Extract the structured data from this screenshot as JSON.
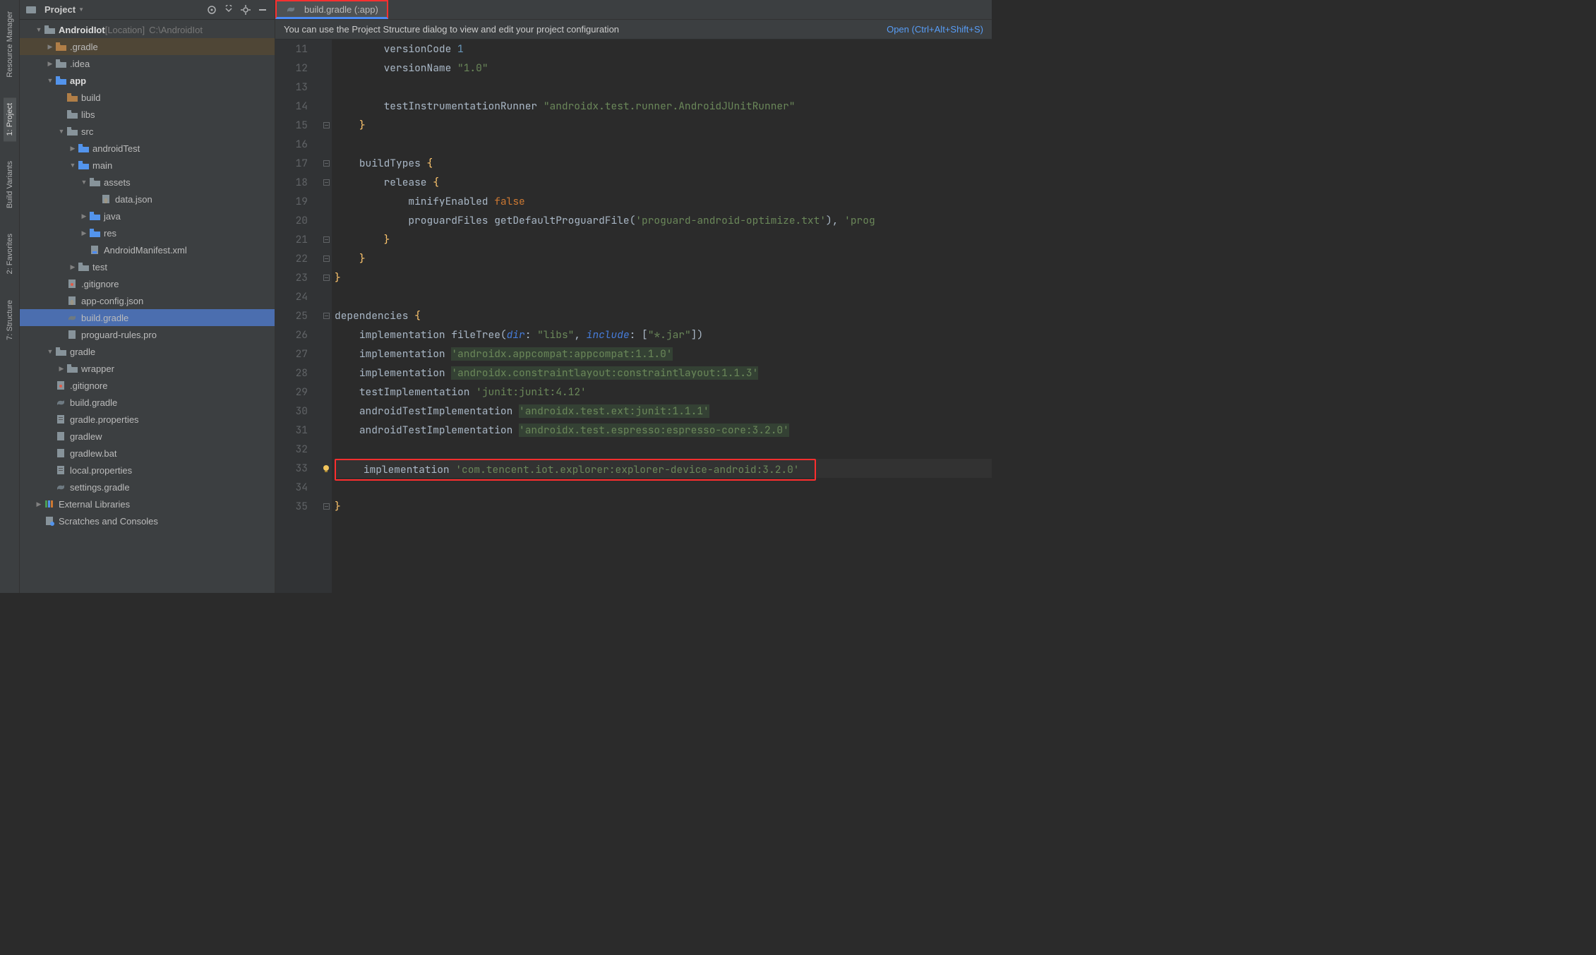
{
  "sidebar": {
    "mode": "Project",
    "root": {
      "name": "AndroidIot",
      "bracket": "[Location]",
      "path": "C:\\AndroidIot"
    },
    "items": [
      {
        "indent": 1,
        "arrow": "down",
        "iconColor": "folder",
        "label": "AndroidIot",
        "bracket": "[Location]",
        "extra": "C:\\AndroidIot",
        "bold": true
      },
      {
        "indent": 2,
        "arrow": "right",
        "iconColor": "folder-y",
        "label": ".gradle",
        "hl": true
      },
      {
        "indent": 2,
        "arrow": "right",
        "iconColor": "folder",
        "label": ".idea"
      },
      {
        "indent": 2,
        "arrow": "down",
        "iconColor": "folder-b",
        "label": "app",
        "bold": true
      },
      {
        "indent": 3,
        "arrow": "",
        "iconColor": "folder-y",
        "label": "build"
      },
      {
        "indent": 3,
        "arrow": "",
        "iconColor": "folder",
        "label": "libs"
      },
      {
        "indent": 3,
        "arrow": "down",
        "iconColor": "folder",
        "label": "src"
      },
      {
        "indent": 4,
        "arrow": "right",
        "iconColor": "folder-b",
        "label": "androidTest"
      },
      {
        "indent": 4,
        "arrow": "down",
        "iconColor": "folder-b",
        "label": "main"
      },
      {
        "indent": 5,
        "arrow": "down",
        "iconColor": "folder",
        "label": "assets",
        "badge": true
      },
      {
        "indent": 6,
        "arrow": "",
        "iconColor": "file",
        "label": "data.json",
        "fileType": "json"
      },
      {
        "indent": 5,
        "arrow": "right",
        "iconColor": "folder-b",
        "label": "java"
      },
      {
        "indent": 5,
        "arrow": "right",
        "iconColor": "folder-b",
        "label": "res"
      },
      {
        "indent": 5,
        "arrow": "",
        "iconColor": "file",
        "label": "AndroidManifest.xml",
        "fileType": "manifest"
      },
      {
        "indent": 4,
        "arrow": "right",
        "iconColor": "folder",
        "label": "test"
      },
      {
        "indent": 3,
        "arrow": "",
        "iconColor": "file",
        "label": ".gitignore",
        "fileType": "gitignore"
      },
      {
        "indent": 3,
        "arrow": "",
        "iconColor": "file",
        "label": "app-config.json",
        "fileType": "json"
      },
      {
        "indent": 3,
        "arrow": "",
        "iconColor": "file",
        "label": "build.gradle",
        "fileType": "gradle",
        "selected": true
      },
      {
        "indent": 3,
        "arrow": "",
        "iconColor": "file",
        "label": "proguard-rules.pro",
        "fileType": "txt"
      },
      {
        "indent": 2,
        "arrow": "down",
        "iconColor": "folder",
        "label": "gradle"
      },
      {
        "indent": 3,
        "arrow": "right",
        "iconColor": "folder",
        "label": "wrapper"
      },
      {
        "indent": 2,
        "arrow": "",
        "iconColor": "file",
        "label": ".gitignore",
        "fileType": "gitignore"
      },
      {
        "indent": 2,
        "arrow": "",
        "iconColor": "file",
        "label": "build.gradle",
        "fileType": "gradle"
      },
      {
        "indent": 2,
        "arrow": "",
        "iconColor": "file",
        "label": "gradle.properties",
        "fileType": "props"
      },
      {
        "indent": 2,
        "arrow": "",
        "iconColor": "file",
        "label": "gradlew",
        "fileType": "txt"
      },
      {
        "indent": 2,
        "arrow": "",
        "iconColor": "file",
        "label": "gradlew.bat",
        "fileType": "txt"
      },
      {
        "indent": 2,
        "arrow": "",
        "iconColor": "file",
        "label": "local.properties",
        "fileType": "props"
      },
      {
        "indent": 2,
        "arrow": "",
        "iconColor": "file",
        "label": "settings.gradle",
        "fileType": "gradle"
      },
      {
        "indent": 1,
        "arrow": "right",
        "iconColor": "lib",
        "label": "External Libraries"
      },
      {
        "indent": 1,
        "arrow": "",
        "iconColor": "scratch",
        "label": "Scratches and Consoles"
      }
    ]
  },
  "leftGutter": [
    {
      "label": "Resource Manager"
    },
    {
      "label": "1: Project",
      "active": true
    },
    {
      "label": "Build Variants"
    },
    {
      "label": "2: Favorites"
    },
    {
      "label": "7: Structure"
    }
  ],
  "tab": {
    "label": "build.gradle (:app)"
  },
  "infoBar": {
    "msg": "You can use the Project Structure dialog to view and edit your project configuration",
    "link": "Open (Ctrl+Alt+Shift+S)"
  },
  "code": {
    "startLine": 11,
    "lines": [
      {
        "n": 11,
        "fold": "",
        "tokens": [
          [
            "        ",
            ""
          ],
          [
            "versionCode ",
            "id"
          ],
          [
            "1",
            "num"
          ]
        ]
      },
      {
        "n": 12,
        "fold": "",
        "tokens": [
          [
            "        ",
            ""
          ],
          [
            "versionName ",
            "id"
          ],
          [
            "\"1.0\"",
            "str"
          ]
        ]
      },
      {
        "n": 13,
        "fold": "",
        "tokens": [
          [
            "",
            ""
          ]
        ]
      },
      {
        "n": 14,
        "fold": "",
        "tokens": [
          [
            "        ",
            ""
          ],
          [
            "testInstrumentationRunner ",
            "id"
          ],
          [
            "\"androidx.test.runner.AndroidJUnitRunner\"",
            "str"
          ]
        ]
      },
      {
        "n": 15,
        "fold": "⊟",
        "tokens": [
          [
            "    ",
            ""
          ],
          [
            "}",
            "bracey"
          ]
        ]
      },
      {
        "n": 16,
        "fold": "",
        "tokens": [
          [
            "",
            ""
          ]
        ]
      },
      {
        "n": 17,
        "fold": "⊟",
        "tokens": [
          [
            "    ",
            ""
          ],
          [
            "buildTypes ",
            "id"
          ],
          [
            "{",
            "bracey"
          ]
        ]
      },
      {
        "n": 18,
        "fold": "⊟",
        "tokens": [
          [
            "        ",
            ""
          ],
          [
            "release ",
            "id"
          ],
          [
            "{",
            "bracey"
          ]
        ]
      },
      {
        "n": 19,
        "fold": "",
        "tokens": [
          [
            "            ",
            ""
          ],
          [
            "minifyEnabled ",
            "id"
          ],
          [
            "false",
            "kw"
          ]
        ]
      },
      {
        "n": 20,
        "fold": "",
        "tokens": [
          [
            "            ",
            ""
          ],
          [
            "proguardFiles ",
            "id"
          ],
          [
            "getDefaultProguardFile",
            "id"
          ],
          [
            "(",
            "brace"
          ],
          [
            "'proguard-android-optimize.txt'",
            "str"
          ],
          [
            ")",
            "brace"
          ],
          [
            ", ",
            "id"
          ],
          [
            "'prog",
            "str"
          ]
        ]
      },
      {
        "n": 21,
        "fold": "⊟",
        "tokens": [
          [
            "        ",
            ""
          ],
          [
            "}",
            "bracey"
          ]
        ]
      },
      {
        "n": 22,
        "fold": "⊟",
        "tokens": [
          [
            "    ",
            ""
          ],
          [
            "}",
            "bracey"
          ]
        ]
      },
      {
        "n": 23,
        "fold": "⊟",
        "tokens": [
          [
            "",
            ""
          ],
          [
            "}",
            "bracey"
          ]
        ]
      },
      {
        "n": 24,
        "fold": "",
        "tokens": [
          [
            "",
            ""
          ]
        ]
      },
      {
        "n": 25,
        "fold": "⊟",
        "run": true,
        "tokens": [
          [
            "",
            ""
          ],
          [
            "dependencies ",
            "id"
          ],
          [
            "{",
            "bracey"
          ]
        ]
      },
      {
        "n": 26,
        "fold": "",
        "tokens": [
          [
            "    ",
            ""
          ],
          [
            "implementation ",
            "id"
          ],
          [
            "fileTree",
            "id"
          ],
          [
            "(",
            "brace"
          ],
          [
            "dir",
            "named"
          ],
          [
            ": ",
            "id"
          ],
          [
            "\"libs\"",
            "str"
          ],
          [
            ", ",
            "id"
          ],
          [
            "include",
            "named"
          ],
          [
            ": [",
            "id"
          ],
          [
            "\"*.jar\"",
            "str"
          ],
          [
            "])",
            "brace"
          ]
        ]
      },
      {
        "n": 27,
        "fold": "",
        "tokens": [
          [
            "    ",
            ""
          ],
          [
            "implementation ",
            "id"
          ],
          [
            "'androidx.appcompat:appcompat:1.1.0'",
            "strhl"
          ]
        ]
      },
      {
        "n": 28,
        "fold": "",
        "tokens": [
          [
            "    ",
            ""
          ],
          [
            "implementation ",
            "id"
          ],
          [
            "'androidx.constraintlayout:constraintlayout:1.1.3'",
            "strhl"
          ]
        ]
      },
      {
        "n": 29,
        "fold": "",
        "tokens": [
          [
            "    ",
            ""
          ],
          [
            "testImplementation ",
            "id"
          ],
          [
            "'junit:junit:4.12'",
            "str"
          ]
        ]
      },
      {
        "n": 30,
        "fold": "",
        "tokens": [
          [
            "    ",
            ""
          ],
          [
            "androidTestImplementation ",
            "id"
          ],
          [
            "'androidx.test.ext:junit:1.1.1'",
            "strhl"
          ]
        ]
      },
      {
        "n": 31,
        "fold": "",
        "tokens": [
          [
            "    ",
            ""
          ],
          [
            "androidTestImplementation ",
            "id"
          ],
          [
            "'androidx.test.espresso:espresso-core:3.2.0'",
            "strhl"
          ]
        ]
      },
      {
        "n": 32,
        "fold": "",
        "tokens": [
          [
            "",
            ""
          ]
        ]
      },
      {
        "n": 33,
        "fold": "",
        "cursor": true,
        "bulb": true,
        "redbox": true,
        "tokens": [
          [
            "    ",
            ""
          ],
          [
            "implementation ",
            "id"
          ],
          [
            "'com.tencent.iot.explorer:explorer-device-android:3.2.0'",
            "str"
          ]
        ]
      },
      {
        "n": 34,
        "fold": "",
        "tokens": [
          [
            "",
            ""
          ]
        ]
      },
      {
        "n": 35,
        "fold": "⊟",
        "tokens": [
          [
            "",
            ""
          ],
          [
            "}",
            "bracey"
          ]
        ]
      }
    ]
  }
}
